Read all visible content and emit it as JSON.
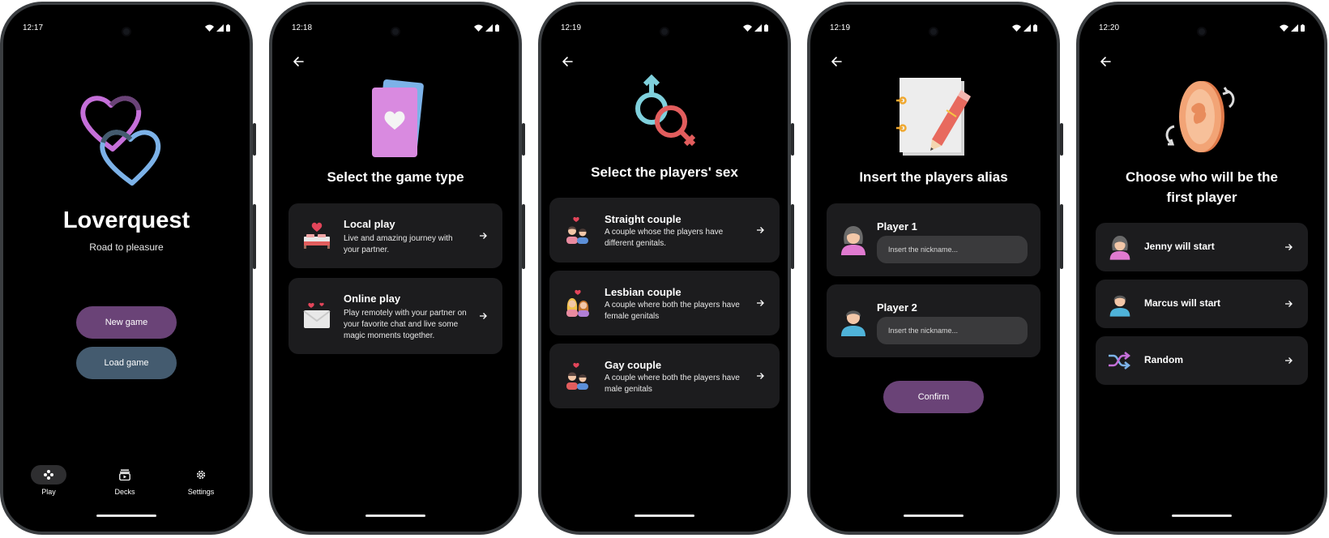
{
  "colors": {
    "purple": "#6a4377",
    "slate": "#445b6f",
    "card": "#1c1c1e",
    "pink_heart": "#c56fd9",
    "blue_heart": "#7cb2e8"
  },
  "screens": [
    {
      "time": "12:17",
      "app_title": "Loverquest",
      "subtitle": "Road to pleasure",
      "new_game": "New game",
      "load_game": "Load game",
      "nav": [
        {
          "label": "Play",
          "icon": "gamepad-icon"
        },
        {
          "label": "Decks",
          "icon": "decks-icon"
        },
        {
          "label": "Settings",
          "icon": "gear-icon"
        }
      ]
    },
    {
      "time": "12:18",
      "title": "Select the game type",
      "cards": [
        {
          "title": "Local play",
          "desc": "Live and amazing journey with your partner.",
          "icon": "bed-heart-icon"
        },
        {
          "title": "Online play",
          "desc": "Play remotely with your partner on your favorite chat and live some magic moments together.",
          "icon": "love-letter-icon"
        }
      ]
    },
    {
      "time": "12:19",
      "title": "Select the players' sex",
      "cards": [
        {
          "title": "Straight couple",
          "desc": "A couple whose the players have different genitals.",
          "icon": "straight-couple-icon"
        },
        {
          "title": "Lesbian couple",
          "desc": "A couple where both the players have female genitals",
          "icon": "lesbian-couple-icon"
        },
        {
          "title": "Gay couple",
          "desc": "A couple where both the players have male genitals",
          "icon": "gay-couple-icon"
        }
      ]
    },
    {
      "time": "12:19",
      "title": "Insert the players alias",
      "players": [
        {
          "label": "Player 1",
          "placeholder": "Insert the nickname...",
          "icon": "woman-avatar-icon"
        },
        {
          "label": "Player 2",
          "placeholder": "Insert the nickname...",
          "icon": "man-avatar-icon"
        }
      ],
      "confirm": "Confirm"
    },
    {
      "time": "12:20",
      "title_line1": "Choose who will be the",
      "title_line2": "first player",
      "options": [
        {
          "label": "Jenny will start",
          "icon": "woman-avatar-icon"
        },
        {
          "label": "Marcus will start",
          "icon": "man-avatar-icon"
        },
        {
          "label": "Random",
          "icon": "shuffle-icon"
        }
      ]
    }
  ]
}
